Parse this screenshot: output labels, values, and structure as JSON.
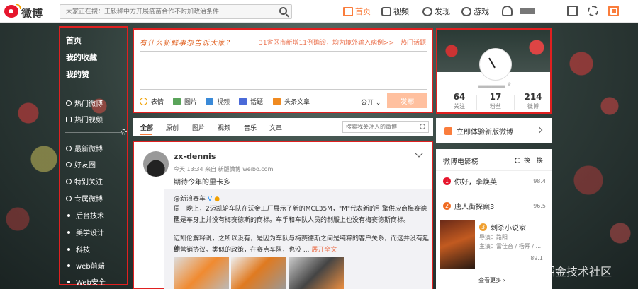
{
  "app": {
    "brand": "微博"
  },
  "search": {
    "placeholder": "大家正在搜：王毅称中方开展疫苗合作不附加政治条件"
  },
  "topnav": {
    "home": "首页",
    "video": "视频",
    "discover": "发现",
    "game": "游戏"
  },
  "leftnav": {
    "home": "首页",
    "favorites": "我的收藏",
    "likes": "我的赞",
    "hot_weibo": "热门微博",
    "hot_video": "热门视频",
    "latest": "最新微博",
    "friends": "好友圈",
    "special": "特别关注",
    "column": "专属微博",
    "groups": [
      "后台技术",
      "美学设计",
      "科技",
      "web前端",
      "Web安全"
    ]
  },
  "composer": {
    "slogan": "有什么新鲜事想告诉大家？",
    "hot_news": "31省区市新增11例确诊，均为境外输入病例>>",
    "hot_topic": "热门话题",
    "tools": [
      "表情",
      "图片",
      "视频",
      "话题",
      "头条文章"
    ],
    "visibility": "公开",
    "publish": "发布"
  },
  "feed_tabs": {
    "tabs": [
      "全部",
      "原创",
      "图片",
      "视频",
      "音乐",
      "文章"
    ],
    "search_placeholder": "搜索我关注人的微博"
  },
  "post": {
    "author": "zx-dennis",
    "meta": "今天 13:34 来自 新版微博 weibo.com",
    "text": "期待今年的里卡多",
    "repost": {
      "source": "@新浪赛车",
      "p1": "周一晚上，2迈凯轮车队在沃金工厂展示了新的MCL35M，\"M\"代表新的引擎供应商梅赛德斯，",
      "p2": "但是车身上并没有梅赛德斯的商标。车手和车队人员的制服上也没有梅赛德斯商标。",
      "p3": "迈凯伦解释说，之所以没有，是因为车队与梅赛德斯之间是纯粹的客户关系，而这并没有延伸",
      "p4": "到营销协议。类似的政策，在赛点车队，也没 ...",
      "expand": "展开全文"
    }
  },
  "profile": {
    "following": "64",
    "following_label": "关注",
    "followers": "17",
    "followers_label": "粉丝",
    "posts": "214",
    "posts_label": "微博"
  },
  "new_version": {
    "label": "立即体验新版微博"
  },
  "movies": {
    "title": "微博电影榜",
    "refresh": "换一换",
    "items": [
      {
        "rank": "1",
        "name": "你好，李焕英",
        "score": "98.4"
      },
      {
        "rank": "2",
        "name": "唐人街探案3",
        "score": "96.5"
      }
    ],
    "featured": {
      "rank": "3",
      "name": "刺杀小说家",
      "director": "导演：路阳",
      "cast": "主演：雷佳音 / 杨幂 / ...",
      "score": "89.1"
    },
    "see_more": "查看更多 ›"
  },
  "watermark": "稀土掘金技术社区",
  "colors": {
    "accent": "#fa7d3c",
    "brand_red": "#e6162d",
    "highlight_border": "#e02020"
  }
}
